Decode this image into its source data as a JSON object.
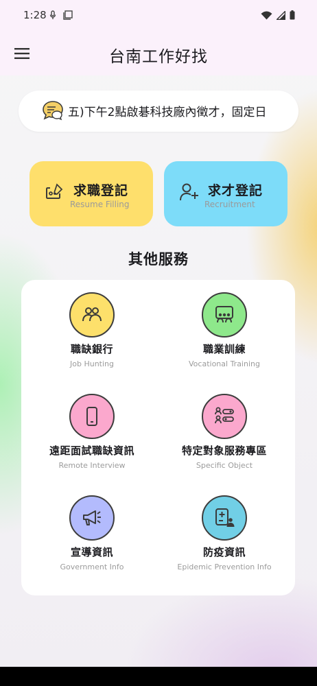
{
  "status_bar": {
    "time": "1:28"
  },
  "app_bar": {
    "title": "台南工作好找"
  },
  "announcement": {
    "text": "五)下午2點啟碁科技廠內徵才，固定日"
  },
  "main_buttons": [
    {
      "title": "求職登記",
      "subtitle": "Resume Filling",
      "color": "#fedf6c"
    },
    {
      "title": "求才登記",
      "subtitle": "Recruitment",
      "color": "#7ddcf9"
    }
  ],
  "services": {
    "title": "其他服務",
    "items": [
      {
        "title": "職缺銀行",
        "subtitle": "Job Hunting",
        "color": "#fde06b",
        "icon": "people-group-icon"
      },
      {
        "title": "職業訓練",
        "subtitle": "Vocational Training",
        "color": "#8ee88b",
        "icon": "classroom-icon"
      },
      {
        "title": "遠距面試職缺資訊",
        "subtitle": "Remote Interview",
        "color": "#fba8cd",
        "icon": "smartphone-icon"
      },
      {
        "title": "特定對象服務專區",
        "subtitle": "Specific Object",
        "color": "#fba8cd",
        "icon": "people-list-icon"
      },
      {
        "title": "宣導資訊",
        "subtitle": "Government Info",
        "color": "#b3bbfd",
        "icon": "megaphone-icon"
      },
      {
        "title": "防疫資訊",
        "subtitle": "Epidemic Prevention Info",
        "color": "#71cfe6",
        "icon": "medical-person-icon"
      }
    ]
  }
}
